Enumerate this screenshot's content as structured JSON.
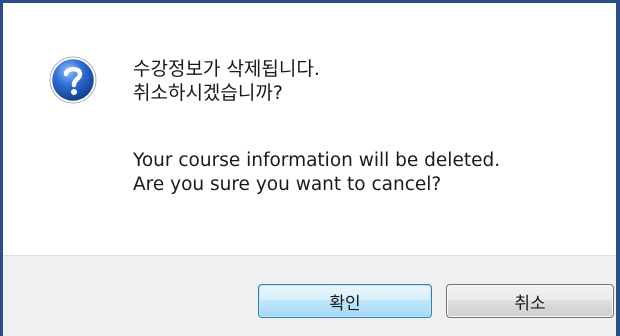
{
  "dialog": {
    "icon": "question-icon",
    "message_ko": [
      "수강정보가 삭제됩니다.",
      "취소하시겠습니까?"
    ],
    "message_en": [
      "Your course information will be deleted.",
      "Are you sure you want to cancel?"
    ]
  },
  "buttons": {
    "ok_label": "확인",
    "cancel_label": "취소"
  },
  "colors": {
    "frame": "#2b4f83",
    "footer": "#f0f0f0",
    "icon_blue": "#2f6fd6"
  }
}
